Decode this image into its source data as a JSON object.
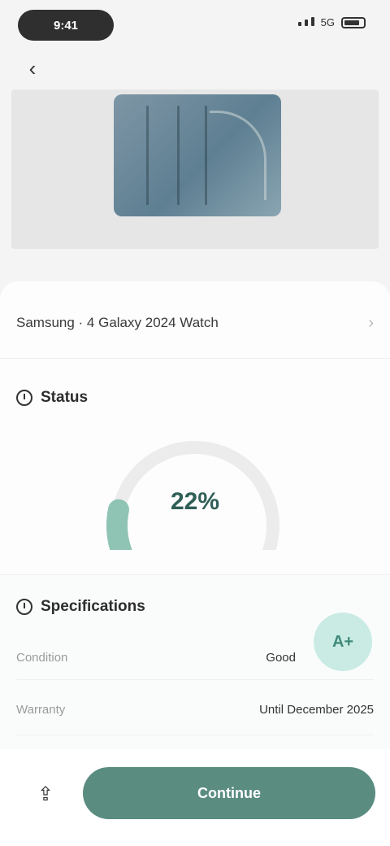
{
  "status_bar": {
    "time": "9:41",
    "network": "5G"
  },
  "product": {
    "name": "Samsung · 4 Galaxy 2024 Watch"
  },
  "gauge_section": {
    "title": "Status"
  },
  "gauge": {
    "value": 22,
    "max": 100,
    "value_label": "22%"
  },
  "info": {
    "title": "Specifications",
    "rows": [
      {
        "label": "Condition",
        "value": "Good"
      },
      {
        "label": "Warranty",
        "value": "Until December 2025"
      }
    ],
    "score_label": "A+"
  },
  "actions": {
    "primary_label": "Continue"
  },
  "colors": {
    "accent": "#5a8c80",
    "gauge_fill": "#8fc4b4",
    "gauge_track": "#ececec",
    "badge_bg": "#c9ebe3"
  }
}
